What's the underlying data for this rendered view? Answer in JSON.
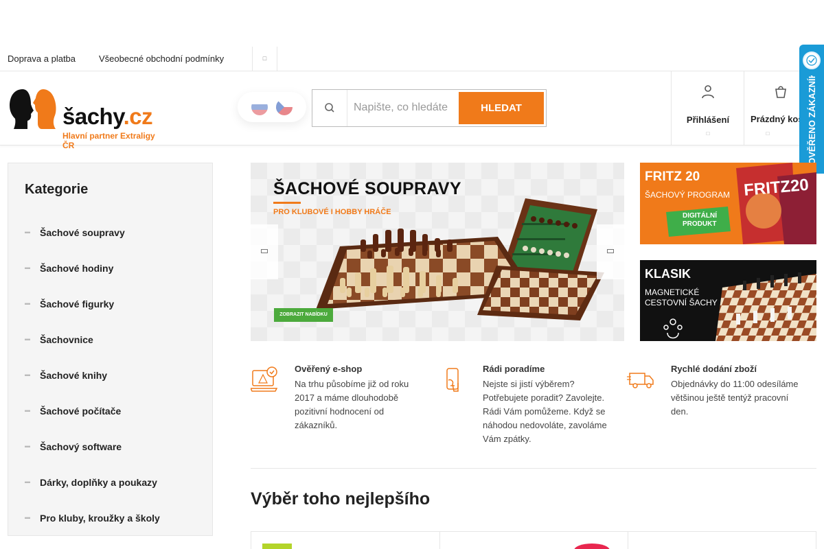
{
  "toplinks": {
    "shipping": "Doprava a platba",
    "terms": "Všeobecné obchodní podmínky"
  },
  "header": {
    "logo_main": "šachy",
    "logo_tld": ".cz",
    "logo_sub": "Hlavní partner Extraligy ČR",
    "search_placeholder": "Napište, co hledáte",
    "search_button": "HLEDAT",
    "login_label": "Přihlášení",
    "cart_label": "Prázdný košík"
  },
  "badge": {
    "text": "OVĚŘENO ZÁKAZNÍKY"
  },
  "sidebar": {
    "title": "Kategorie",
    "items": [
      {
        "label": "Šachové soupravy"
      },
      {
        "label": "Šachové hodiny"
      },
      {
        "label": "Šachové figurky"
      },
      {
        "label": "Šachovnice"
      },
      {
        "label": "Šachové knihy"
      },
      {
        "label": "Šachové počítače"
      },
      {
        "label": "Šachový software"
      },
      {
        "label": "Dárky, doplňky a poukazy"
      },
      {
        "label": "Pro kluby, kroužky a školy"
      }
    ]
  },
  "hero": {
    "title": "ŠACHOVÉ SOUPRAVY",
    "subtitle": "PRO KLUBOVÉ I HOBBY HRÁČE",
    "cta": "ZOBRAZIT NABÍDKU"
  },
  "banners": {
    "fritz_title": "FRITZ 20",
    "fritz_sub": "ŠACHOVÝ PROGRAM",
    "fritz_tag1": "DIGITÁLNÍ",
    "fritz_tag2": "PRODUKT",
    "fritz_box": "FRITZ20",
    "klasik_title": "KLASIK",
    "klasik_sub1": "MAGNETICKÉ",
    "klasik_sub2": "CESTOVNÍ ŠACHY"
  },
  "features": [
    {
      "icon": "laptop-check-icon",
      "title": "Ověřený e-shop",
      "text": "Na trhu působíme již od roku 2017 a máme dlouhodobě pozitivní hodnocení od zákazníků."
    },
    {
      "icon": "phone-icon",
      "title": "Rádi poradíme",
      "text": "Nejste si jistí výběrem? Potřebujete poradit? Zavolejte. Rádi Vám pomůžeme. Když se náhodou nedovoláte, zavoláme Vám zpátky."
    },
    {
      "icon": "truck-icon",
      "title": "Rychlé dodání zboží",
      "text": "Objednávky do 11:00 odesíláme většinou ještě tentýž pracovní den."
    }
  ],
  "section": {
    "title": "Výběr toho nejlepšího"
  },
  "colors": {
    "accent": "#f07a1a",
    "badge": "#1a9bd7",
    "cta_green": "#4caa3c"
  }
}
